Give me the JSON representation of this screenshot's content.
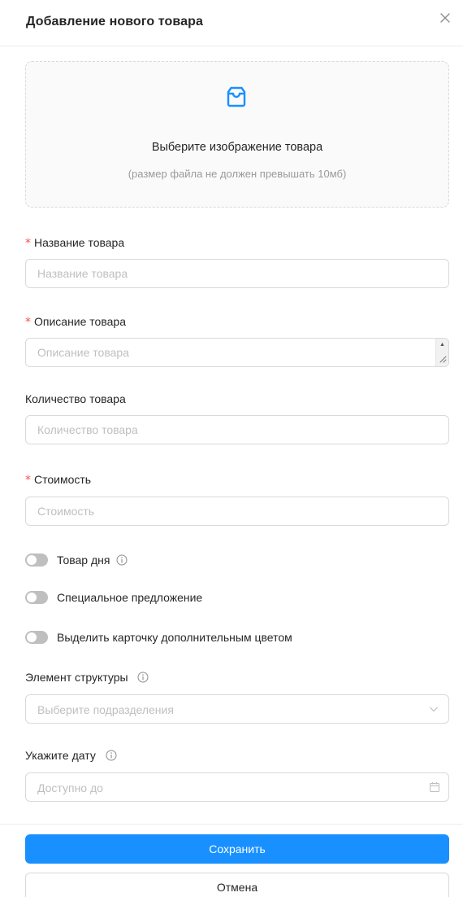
{
  "modal": {
    "title": "Добавление нового товара",
    "close_icon": "close-icon"
  },
  "upload": {
    "icon": "inbox-icon",
    "title": "Выберите изображение товара",
    "hint": "(размер файла не должен превышать 10мб)"
  },
  "fields": {
    "name": {
      "label": "Название товара",
      "required": true,
      "placeholder": "Название товара",
      "value": ""
    },
    "description": {
      "label": "Описание товара",
      "required": true,
      "placeholder": "Описание товара",
      "value": ""
    },
    "quantity": {
      "label": "Количество товара",
      "required": false,
      "placeholder": "Количество товара",
      "value": ""
    },
    "price": {
      "label": "Стоимость",
      "required": true,
      "placeholder": "Стоимость",
      "value": ""
    }
  },
  "required_mark": "*",
  "toggles": [
    {
      "label": "Товар дня",
      "checked": false,
      "has_info": true
    },
    {
      "label": "Специальное предложение",
      "checked": false,
      "has_info": false
    },
    {
      "label": "Выделить карточку дополнительным цветом",
      "checked": false,
      "has_info": false
    }
  ],
  "structure": {
    "label": "Элемент структуры",
    "placeholder": "Выберите подразделения",
    "icon": "chevron-down-icon"
  },
  "date": {
    "label": "Укажите дату",
    "placeholder": "Доступно до",
    "icon": "calendar-icon"
  },
  "buttons": {
    "save": "Сохранить",
    "cancel": "Отмена"
  },
  "colors": {
    "primary": "#1890ff",
    "required": "#ff4d4f",
    "switch_off": "#bfbfbf",
    "border": "#d9d9d9",
    "placeholder": "#bfbfbf"
  }
}
